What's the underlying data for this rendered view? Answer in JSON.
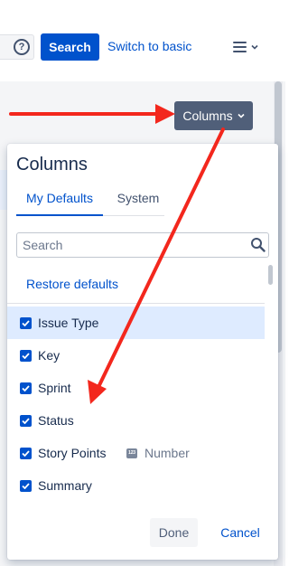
{
  "header": {
    "help_icon": "?",
    "search_button": "Search",
    "switch_link": "Switch to basic",
    "menu_icon": "hamburger-menu-icon"
  },
  "columns_button": {
    "label": "Columns",
    "chevron": "⌄"
  },
  "dropdown": {
    "title": "Columns",
    "tabs": [
      {
        "label": "My Defaults",
        "active": true
      },
      {
        "label": "System",
        "active": false
      }
    ],
    "search": {
      "placeholder": "Search",
      "value": ""
    },
    "restore_label": "Restore defaults",
    "items": [
      {
        "label": "Issue Type",
        "checked": true,
        "highlighted": true
      },
      {
        "label": "Key",
        "checked": true
      },
      {
        "label": "Sprint",
        "checked": true
      },
      {
        "label": "Status",
        "checked": true
      },
      {
        "label": "Story Points",
        "checked": true,
        "type_badge": "123",
        "type_label": "Number"
      },
      {
        "label": "Summary",
        "checked": true
      }
    ],
    "done_label": "Done",
    "cancel_label": "Cancel"
  },
  "annotation": {
    "arrow_color": "#f3271d"
  }
}
